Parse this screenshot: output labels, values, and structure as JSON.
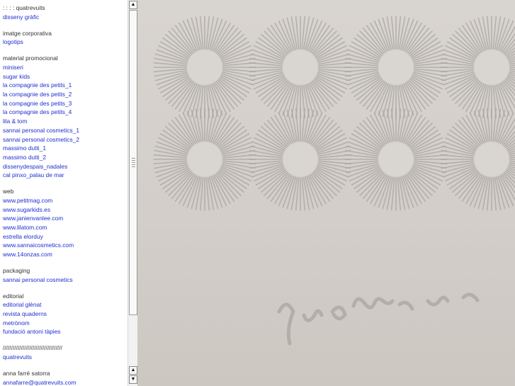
{
  "nav": {
    "groups": [
      {
        "heading": ": : : : quatrevuits",
        "links": [
          "disseny gràfic"
        ]
      },
      {
        "heading": "imatge corporativa",
        "links": [
          "logotips"
        ]
      },
      {
        "heading": "material promocional",
        "links": [
          "miniseri",
          "sugar kids",
          "la compagnie des petits_1",
          "la compagnie des petits_2",
          "la compagnie des petits_3",
          "la compagnie des petits_4",
          "lila & tom",
          "sannai personal cosmetics_1",
          "sannai personal cosmetics_2",
          "massimo dutti_1",
          "massimo dutti_2",
          "dissenydespais_nadales",
          "cal pinxo_palau de mar"
        ]
      },
      {
        "heading": "web",
        "links": [
          "www.petitmag.com",
          "www.sugarkids.es",
          "www.janienvanlee.com",
          "www.lilatom.com",
          "estrella elorduy",
          "www.sannaicosmetics.com",
          "www.14onzas.com"
        ]
      },
      {
        "heading": "packaging",
        "links": [
          "sannai personal cosmetics"
        ]
      },
      {
        "heading": "editorial",
        "links": [
          "editorial glènat",
          "revista quaderns",
          "metrònom",
          "fundació antoni tàpies"
        ]
      },
      {
        "heading": "////////////////////////////////////",
        "links": [
          "quatrevuits"
        ]
      },
      {
        "heading": "anna farré satorra",
        "links": [
          "annafarre@quatrevuits.com"
        ]
      }
    ]
  },
  "scrollbar": {
    "up_arrow": "▲",
    "down_arrow": "▼"
  },
  "photo": {
    "icon": "photo-image"
  }
}
